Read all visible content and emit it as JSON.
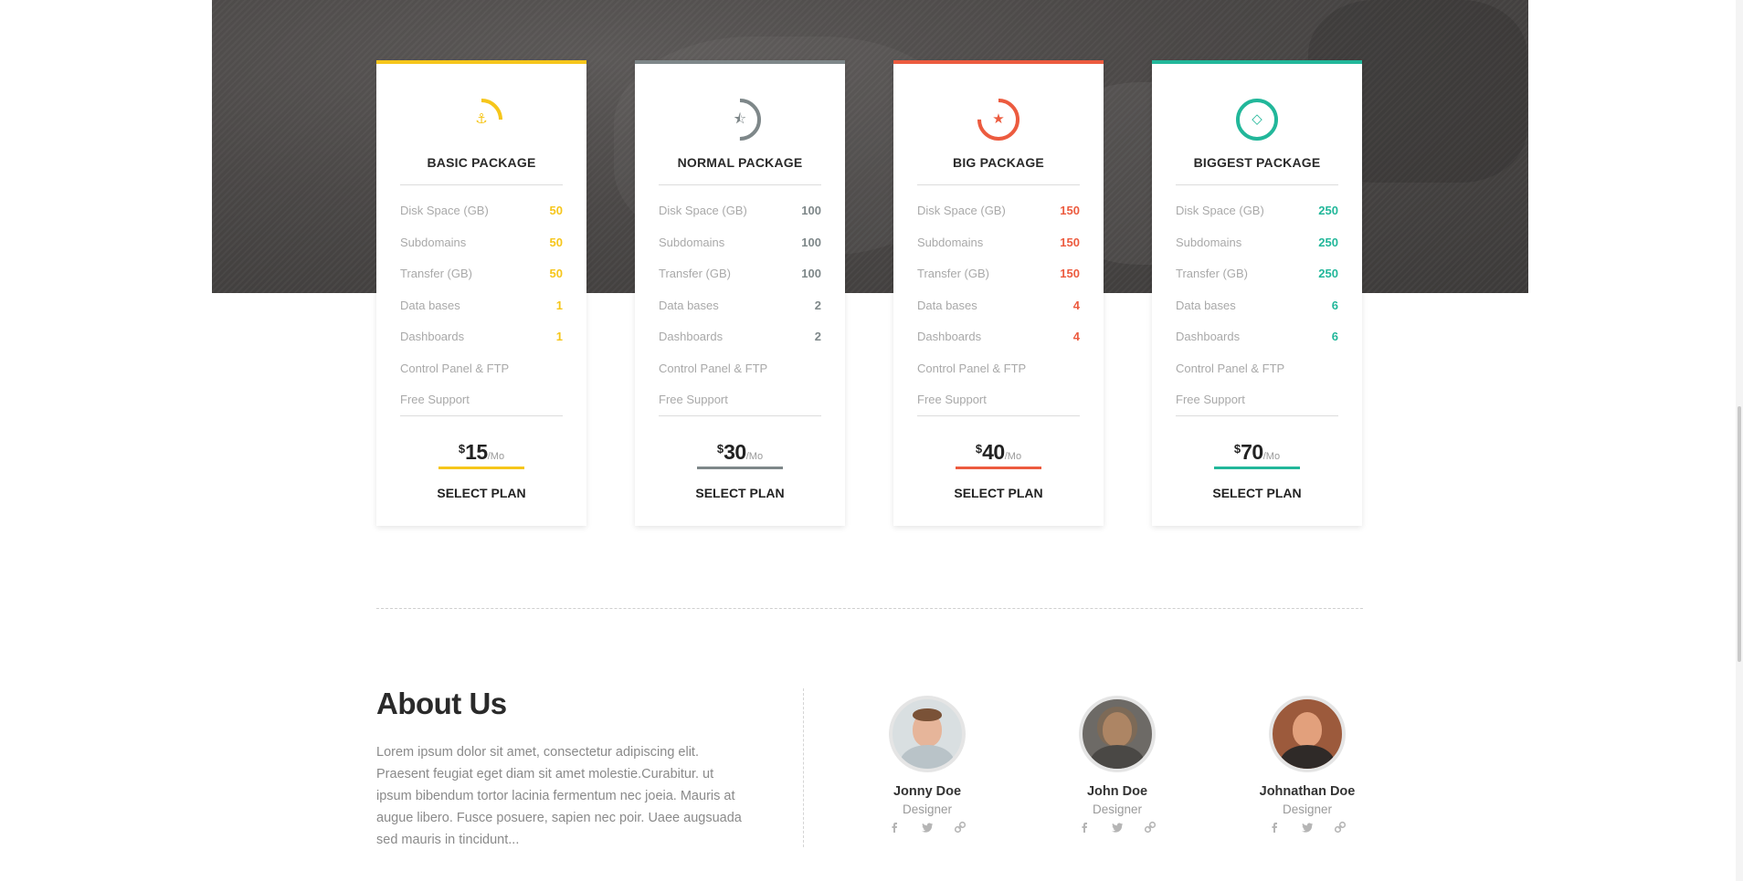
{
  "colors": {
    "basic_accent": "#f6c61b",
    "normal_accent": "#7e8789",
    "big_accent": "#ec5b3f",
    "biggest_accent": "#22b79a"
  },
  "pricing": {
    "plans": [
      {
        "title": "BASIC PACKAGE",
        "icon": "anchor-icon",
        "ring_progress": 0.25,
        "features": [
          {
            "label": "Disk Space (GB)",
            "value": "50"
          },
          {
            "label": "Subdomains",
            "value": "50"
          },
          {
            "label": "Transfer (GB)",
            "value": "50"
          },
          {
            "label": "Data bases",
            "value": "1"
          },
          {
            "label": "Dashboards",
            "value": "1"
          },
          {
            "label": "Control Panel & FTP",
            "value": ""
          },
          {
            "label": "Free Support",
            "value": ""
          }
        ],
        "currency": "$",
        "price": "15",
        "period": "/Mo",
        "cta": "SELECT PLAN"
      },
      {
        "title": "NORMAL PACKAGE",
        "icon": "half-star-icon",
        "ring_progress": 0.5,
        "features": [
          {
            "label": "Disk Space (GB)",
            "value": "100"
          },
          {
            "label": "Subdomains",
            "value": "100"
          },
          {
            "label": "Transfer (GB)",
            "value": "100"
          },
          {
            "label": "Data bases",
            "value": "2"
          },
          {
            "label": "Dashboards",
            "value": "2"
          },
          {
            "label": "Control Panel & FTP",
            "value": ""
          },
          {
            "label": "Free Support",
            "value": ""
          }
        ],
        "currency": "$",
        "price": "30",
        "period": "/Mo",
        "cta": "SELECT PLAN"
      },
      {
        "title": "BIG PACKAGE",
        "icon": "star-icon",
        "ring_progress": 0.75,
        "features": [
          {
            "label": "Disk Space (GB)",
            "value": "150"
          },
          {
            "label": "Subdomains",
            "value": "150"
          },
          {
            "label": "Transfer (GB)",
            "value": "150"
          },
          {
            "label": "Data bases",
            "value": "4"
          },
          {
            "label": "Dashboards",
            "value": "4"
          },
          {
            "label": "Control Panel & FTP",
            "value": ""
          },
          {
            "label": "Free Support",
            "value": ""
          }
        ],
        "currency": "$",
        "price": "40",
        "period": "/Mo",
        "cta": "SELECT PLAN"
      },
      {
        "title": "BIGGEST PACKAGE",
        "icon": "diamond-icon",
        "ring_progress": 1.0,
        "features": [
          {
            "label": "Disk Space (GB)",
            "value": "250"
          },
          {
            "label": "Subdomains",
            "value": "250"
          },
          {
            "label": "Transfer (GB)",
            "value": "250"
          },
          {
            "label": "Data bases",
            "value": "6"
          },
          {
            "label": "Dashboards",
            "value": "6"
          },
          {
            "label": "Control Panel & FTP",
            "value": ""
          },
          {
            "label": "Free Support",
            "value": ""
          }
        ],
        "currency": "$",
        "price": "70",
        "period": "/Mo",
        "cta": "SELECT PLAN"
      }
    ]
  },
  "about": {
    "title": "About Us",
    "text": "Lorem ipsum dolor sit amet, consectetur adipiscing elit. Praesent feugiat eget diam sit amet molestie.Curabitur. ut ipsum bibendum tortor lacinia fermentum nec joeia. Mauris at augue libero. Fusce posuere, sapien nec poir. Uaee augsuada sed mauris in tincidunt...",
    "team": [
      {
        "name": "Jonny Doe",
        "role": "Designer",
        "socials": [
          "facebook-icon",
          "twitter-icon",
          "link-icon"
        ]
      },
      {
        "name": "John Doe",
        "role": "Designer",
        "socials": [
          "facebook-icon",
          "twitter-icon",
          "link-icon"
        ]
      },
      {
        "name": "Johnathan Doe",
        "role": "Designer",
        "socials": [
          "facebook-icon",
          "twitter-icon",
          "link-icon"
        ]
      }
    ]
  }
}
